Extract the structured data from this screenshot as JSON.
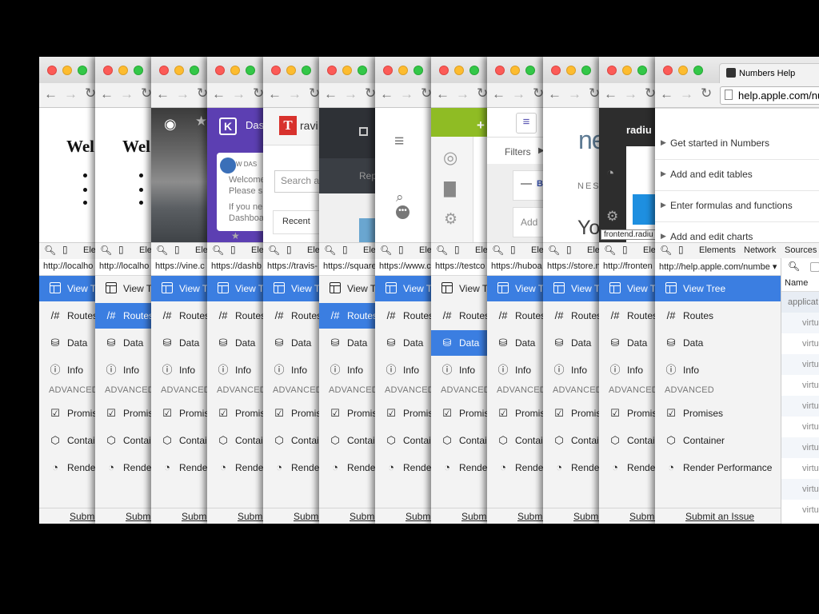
{
  "devtools": {
    "search_icon": "search-icon",
    "device_icon": "device-icon",
    "elements_tab_short": "Ele",
    "elements_tab": "Elements",
    "network_tab": "Network",
    "sources_tab": "Sources"
  },
  "sidebar": {
    "view_tree": "View Tree",
    "view_tree_short": "View T",
    "routes": "Routes",
    "data": "Data",
    "info": "Info",
    "advanced": "ADVANCED",
    "promises": "Promises",
    "promises_short": "Promis",
    "container": "Container",
    "container_short": "Contai",
    "render_performance": "Render Performance",
    "render_short": "Render"
  },
  "footer": {
    "submit_issue": "Submit an Issue",
    "submit_short": "Submi"
  },
  "windows": [
    {
      "url": "http://localho",
      "active": "view_tree"
    },
    {
      "url": "http://localho",
      "active": "routes"
    },
    {
      "url": "https://vine.c",
      "active": "view_tree"
    },
    {
      "url": "https://dashb",
      "active": "view_tree"
    },
    {
      "url": "https://travis-",
      "active": "view_tree"
    },
    {
      "url": "https://square",
      "active": "routes"
    },
    {
      "url": "https://www.c",
      "active": "view_tree"
    },
    {
      "url": "https://testco",
      "active": "data"
    },
    {
      "url": "https://huboa",
      "active": "view_tree"
    },
    {
      "url": "https://store.n",
      "active": "view_tree"
    },
    {
      "url": "http://fronten",
      "active": "view_tree"
    },
    {
      "url": "http://help.apple.com/numbe ▾",
      "active": "view_tree"
    }
  ],
  "page_texts": {
    "welcome_fragment": "Wel",
    "dash_fragment": "Das",
    "dash_card_name": "W DAS",
    "dash_welcome": "Welcome",
    "dash_please": "Please s",
    "dash_if_you": "If you ne",
    "dash_dashboard": "Dashboa",
    "travis_fragment": "ravi",
    "travis_search": "Search a",
    "travis_recent": "Recent",
    "square_rep": "Rep",
    "filters": "Filters",
    "add": "Add",
    "b_letter": "B",
    "ne_fragment": "ne",
    "nest_fragment": "NEST",
    "yo_fragment": "Yo",
    "radium_fragment": "radiu",
    "frontend_tooltip": "frontend.radiu"
  },
  "apple_help": {
    "tab_title": "Numbers Help",
    "omnibox": "help.apple.com/nu",
    "items": [
      "Get started in Numbers",
      "Add and edit tables",
      "Enter formulas and functions",
      "Add and edit charts"
    ]
  },
  "network_panel": {
    "name_header": "Name",
    "first_row": "applicat",
    "row_fragment": "virtu"
  }
}
